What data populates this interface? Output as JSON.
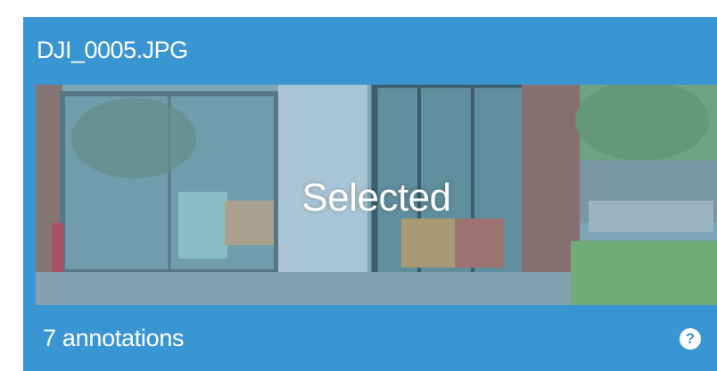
{
  "card": {
    "filename": "DJI_0005.JPG",
    "overlay_label": "Selected",
    "annotations_text": "7 annotations",
    "help_icon": "question-circle-icon",
    "help_glyph": "?",
    "colors": {
      "card_background": "#3a95d3",
      "text": "#ffffff"
    }
  }
}
